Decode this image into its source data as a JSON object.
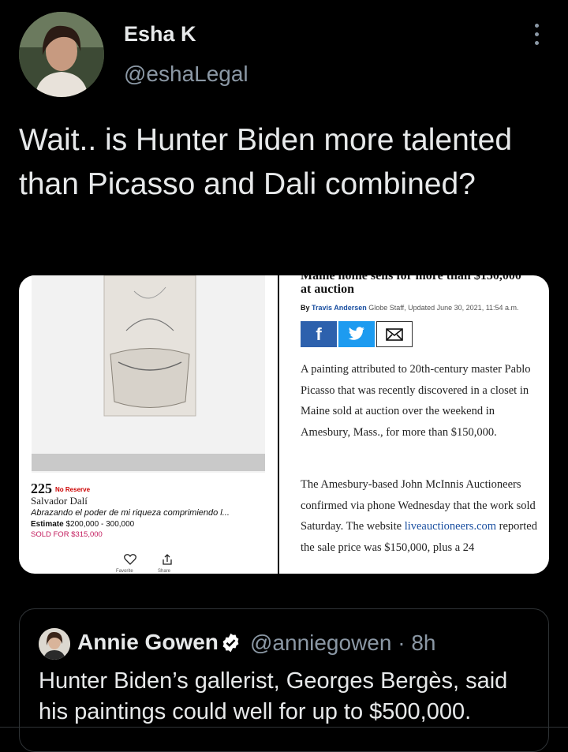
{
  "tweet": {
    "author_name": "Esha K",
    "author_handle": "@eshaLegal",
    "text": "Wait.. is Hunter Biden more talented than Picasso and Dali combined?"
  },
  "media_left": {
    "lot_number": "225",
    "lot_flag": "No Reserve",
    "artist": "Salvador Dalí",
    "work_title": "Abrazando el poder de mi riqueza comprimiendo l...",
    "estimate_label": "Estimate",
    "estimate_value": "$200,000 - 300,000",
    "sold_text": "SOLD FOR $315,000",
    "favorite_label": "Favorite",
    "share_label": "Share"
  },
  "media_right": {
    "headline_partial": "Maine home sells for more than $150,000",
    "headline_end": "at auction",
    "byline_by": "By",
    "byline_author": "Travis Andersen",
    "byline_rest": "Globe Staff, Updated June 30, 2021, 11:54 a.m.",
    "para1": "A painting attributed to 20th-century master Pablo Picasso that was recently discovered in a closet in Maine sold at auction over the weekend in Amesbury, Mass., for more than $150,000.",
    "para2_start": "The Amesbury-based John McInnis Auctioneers confirmed via phone Wednesday that the work sold Saturday. The website ",
    "para2_link": "liveauctioneers.com",
    "para2_end": " reported the sale price was $150,000, plus a 24"
  },
  "quote_tweet": {
    "author_name": "Annie Gowen",
    "author_handle": "@anniegowen",
    "time": "· 8h",
    "text": "Hunter Biden’s gallerist, Georges Bergès, said his paintings could well for up to $500,000."
  },
  "colors": {
    "background": "#000000",
    "secondary_text": "#8b98a5",
    "verified": "#ffffff",
    "sold_pink": "#c2185b"
  },
  "icons": [
    "more-vertical-icon",
    "facebook-icon",
    "twitter-icon",
    "email-icon",
    "heart-icon",
    "share-icon",
    "verified-badge-icon"
  ]
}
